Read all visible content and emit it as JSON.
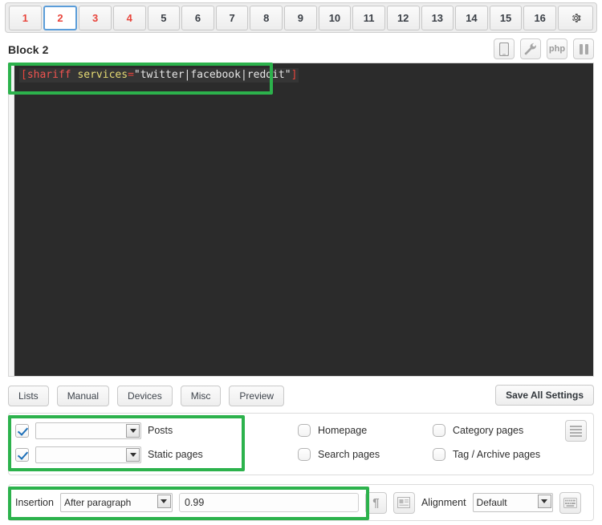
{
  "tabs": [
    {
      "label": "1",
      "state": "has-content"
    },
    {
      "label": "2",
      "state": "active"
    },
    {
      "label": "3",
      "state": "has-content"
    },
    {
      "label": "4",
      "state": "has-content"
    },
    {
      "label": "5",
      "state": "empty"
    },
    {
      "label": "6",
      "state": "empty"
    },
    {
      "label": "7",
      "state": "empty"
    },
    {
      "label": "8",
      "state": "empty"
    },
    {
      "label": "9",
      "state": "empty"
    },
    {
      "label": "10",
      "state": "empty"
    },
    {
      "label": "11",
      "state": "empty"
    },
    {
      "label": "12",
      "state": "empty"
    },
    {
      "label": "13",
      "state": "empty"
    },
    {
      "label": "14",
      "state": "empty"
    },
    {
      "label": "15",
      "state": "empty"
    },
    {
      "label": "16",
      "state": "empty"
    }
  ],
  "settings_tab": {
    "icon": "gear-icon"
  },
  "block": {
    "title": "Block 2",
    "tools": [
      {
        "name": "device-icon",
        "label": ""
      },
      {
        "name": "wrench-icon",
        "label": ""
      },
      {
        "name": "php-icon",
        "label": "php"
      },
      {
        "name": "pause-icon",
        "label": ""
      }
    ]
  },
  "editor": {
    "code": "[shariff services=\"twitter|facebook|reddit\"]",
    "tokens": {
      "open_bracket": "[",
      "tag": "shariff",
      "space": " ",
      "attribute": "services",
      "equals": "=",
      "value": "\"twitter|facebook|reddit\"",
      "close_bracket": "]"
    },
    "background": "#2b2b2b"
  },
  "toolbar": {
    "buttons": [
      "Lists",
      "Manual",
      "Devices",
      "Misc",
      "Preview"
    ],
    "save_label": "Save All Settings"
  },
  "display_options": {
    "left": [
      {
        "label": "Posts",
        "checked": true,
        "select_value": ""
      },
      {
        "label": "Static pages",
        "checked": true,
        "select_value": ""
      }
    ],
    "right": [
      {
        "label": "Homepage",
        "checked": false
      },
      {
        "label": "Category pages",
        "checked": false
      },
      {
        "label": "Search pages",
        "checked": false
      },
      {
        "label": "Tag / Archive pages",
        "checked": false
      }
    ],
    "list_button": "hamburger-icon"
  },
  "insertion": {
    "label": "Insertion",
    "mode": "After paragraph",
    "value": "0.99",
    "paragraph_button": "pilcrow-icon",
    "layout_button": "text-wrap-icon",
    "alignment_label": "Alignment",
    "alignment_value": "Default",
    "keyboard_button": "keyboard-icon"
  },
  "highlights": {
    "accent_color": "#2cb24c",
    "regions": [
      "code-editor-line",
      "post-type-checkboxes",
      "insertion-settings"
    ]
  }
}
